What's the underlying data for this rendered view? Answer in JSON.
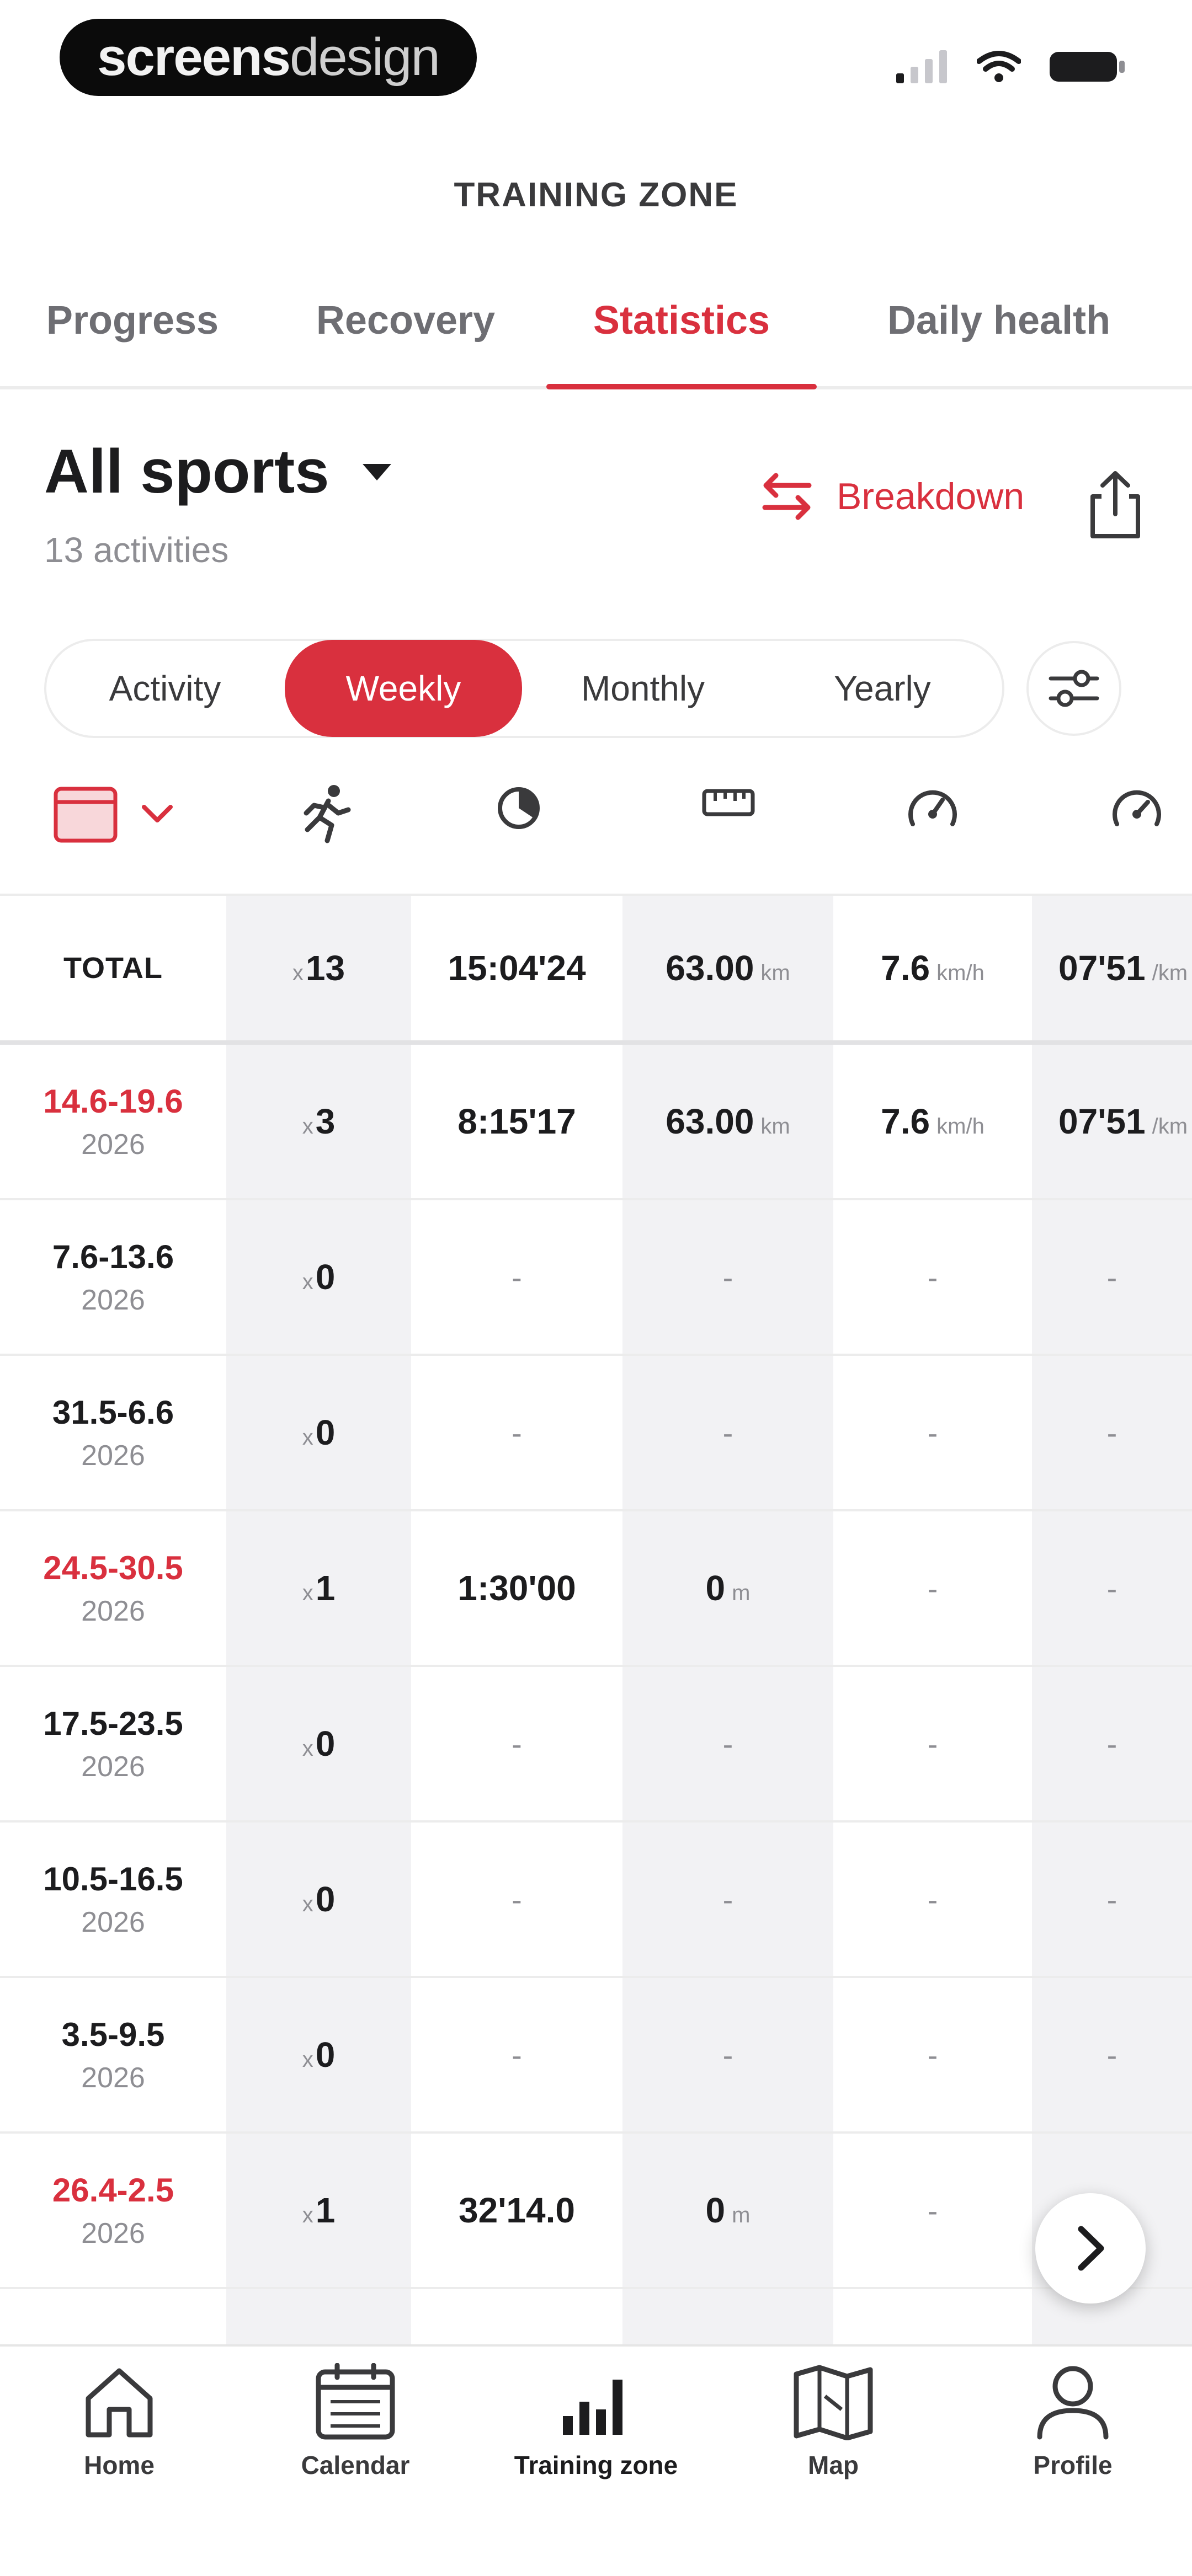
{
  "status": {
    "brand_bold": "screens",
    "brand_light": "design"
  },
  "header": {
    "title": "TRAINING ZONE"
  },
  "tabs": [
    {
      "label": "Progress",
      "active": false
    },
    {
      "label": "Recovery",
      "active": false
    },
    {
      "label": "Statistics",
      "active": true
    },
    {
      "label": "Daily health",
      "active": false
    }
  ],
  "sport": {
    "title": "All sports",
    "count": "13 activities",
    "breakdown_label": "Breakdown"
  },
  "periods": [
    {
      "label": "Activity",
      "active": false
    },
    {
      "label": "Weekly",
      "active": true
    },
    {
      "label": "Monthly",
      "active": false
    },
    {
      "label": "Yearly",
      "active": false
    }
  ],
  "columns": [
    {
      "icon": "calendar-icon"
    },
    {
      "icon": "runner-icon"
    },
    {
      "icon": "duration-icon"
    },
    {
      "icon": "distance-icon"
    },
    {
      "icon": "speed-icon"
    },
    {
      "icon": "pace-icon"
    }
  ],
  "table": {
    "total": {
      "label": "TOTAL",
      "count_prefix": "x",
      "count": "13",
      "duration": "15:04'24",
      "distance": "63.00",
      "distance_unit": "km",
      "speed": "7.6",
      "speed_unit": "km/h",
      "pace": "07'51",
      "pace_unit": "/km"
    },
    "rows": [
      {
        "range": "14.6-19.6",
        "year": "2026",
        "highlight": true,
        "count": "3",
        "duration": "8:15'17",
        "distance": "63.00",
        "distance_unit": "km",
        "speed": "7.6",
        "speed_unit": "km/h",
        "pace": "07'51",
        "pace_unit": "/km"
      },
      {
        "range": "7.6-13.6",
        "year": "2026",
        "highlight": false,
        "count": "0",
        "duration": "-",
        "distance": "-",
        "distance_unit": "",
        "speed": "-",
        "speed_unit": "",
        "pace": "-",
        "pace_unit": ""
      },
      {
        "range": "31.5-6.6",
        "year": "2026",
        "highlight": false,
        "count": "0",
        "duration": "-",
        "distance": "-",
        "distance_unit": "",
        "speed": "-",
        "speed_unit": "",
        "pace": "-",
        "pace_unit": ""
      },
      {
        "range": "24.5-30.5",
        "year": "2026",
        "highlight": true,
        "count": "1",
        "duration": "1:30'00",
        "distance": "0",
        "distance_unit": "m",
        "speed": "-",
        "speed_unit": "",
        "pace": "-",
        "pace_unit": ""
      },
      {
        "range": "17.5-23.5",
        "year": "2026",
        "highlight": false,
        "count": "0",
        "duration": "-",
        "distance": "-",
        "distance_unit": "",
        "speed": "-",
        "speed_unit": "",
        "pace": "-",
        "pace_unit": ""
      },
      {
        "range": "10.5-16.5",
        "year": "2026",
        "highlight": false,
        "count": "0",
        "duration": "-",
        "distance": "-",
        "distance_unit": "",
        "speed": "-",
        "speed_unit": "",
        "pace": "-",
        "pace_unit": ""
      },
      {
        "range": "3.5-9.5",
        "year": "2026",
        "highlight": false,
        "count": "0",
        "duration": "-",
        "distance": "-",
        "distance_unit": "",
        "speed": "-",
        "speed_unit": "",
        "pace": "-",
        "pace_unit": ""
      },
      {
        "range": "26.4-2.5",
        "year": "2026",
        "highlight": true,
        "count": "1",
        "duration": "32'14.0",
        "distance": "0",
        "distance_unit": "m",
        "speed": "-",
        "speed_unit": "",
        "pace": "-",
        "pace_unit": ""
      }
    ]
  },
  "nav": [
    {
      "label": "Home",
      "icon": "home-icon",
      "active": false
    },
    {
      "label": "Calendar",
      "icon": "calendar-icon",
      "active": false
    },
    {
      "label": "Training zone",
      "icon": "bar-chart-icon",
      "active": true
    },
    {
      "label": "Map",
      "icon": "map-icon",
      "active": false
    },
    {
      "label": "Profile",
      "icon": "profile-icon",
      "active": false
    }
  ],
  "colors": {
    "accent": "#d9303e",
    "text": "#1c1c1e",
    "muted": "#8e8e93",
    "shade": "#f2f2f4"
  }
}
